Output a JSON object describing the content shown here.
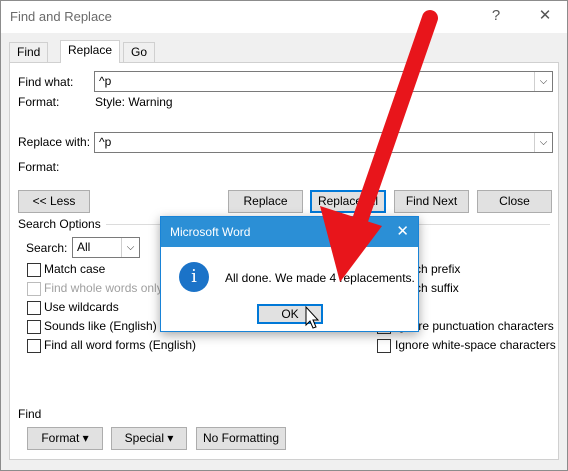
{
  "window": {
    "title": "Find and Replace",
    "help": "?",
    "close": "✕"
  },
  "tabs": [
    {
      "label": "Find"
    },
    {
      "label": "Replace"
    },
    {
      "label": "Go To"
    }
  ],
  "find": {
    "label": "Find what:",
    "value": "^p",
    "format_label": "Format:",
    "format_value": "Style: Warning"
  },
  "replace": {
    "label": "Replace with:",
    "value": "^p",
    "format_label": "Format:"
  },
  "buttons": {
    "less": "<< Less",
    "replace": "Replace",
    "replace_all": "Replace All",
    "find_next": "Find Next",
    "close": "Close"
  },
  "search_options": {
    "heading": "Search Options",
    "search_label": "Search:",
    "search_value": "All",
    "left": [
      {
        "label": "Match case",
        "disabled": false
      },
      {
        "label": "Find whole words only",
        "disabled": true
      },
      {
        "label": "Use wildcards",
        "disabled": false
      },
      {
        "label": "Sounds like (English)",
        "disabled": false
      },
      {
        "label": "Find all word forms (English)",
        "disabled": false
      }
    ],
    "right": [
      {
        "label": "Match prefix"
      },
      {
        "label": "Match suffix"
      },
      {
        "label": "Ignore punctuation characters"
      },
      {
        "label": "Ignore white-space characters"
      }
    ]
  },
  "bottom": {
    "heading": "Find",
    "format_btn": "Format ▾",
    "special_btn": "Special ▾",
    "no_formatting_btn": "No Formatting"
  },
  "dialog": {
    "title": "Microsoft Word",
    "close": "✕",
    "icon": "i",
    "message": "All done. We made 4 replacements.",
    "ok": "OK"
  },
  "overlay": {
    "arrow_color": "#e8151b"
  }
}
